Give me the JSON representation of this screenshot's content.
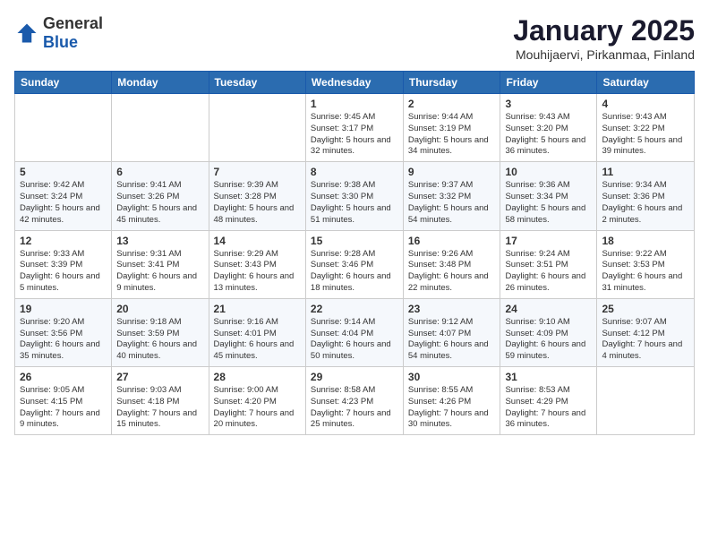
{
  "header": {
    "logo": {
      "general": "General",
      "blue": "Blue"
    },
    "title": "January 2025",
    "subtitle": "Mouhijaervi, Pirkanmaa, Finland"
  },
  "weekdays": [
    "Sunday",
    "Monday",
    "Tuesday",
    "Wednesday",
    "Thursday",
    "Friday",
    "Saturday"
  ],
  "weeks": [
    [
      {
        "day": "",
        "info": ""
      },
      {
        "day": "",
        "info": ""
      },
      {
        "day": "",
        "info": ""
      },
      {
        "day": "1",
        "info": "Sunrise: 9:45 AM\nSunset: 3:17 PM\nDaylight: 5 hours and 32 minutes."
      },
      {
        "day": "2",
        "info": "Sunrise: 9:44 AM\nSunset: 3:19 PM\nDaylight: 5 hours and 34 minutes."
      },
      {
        "day": "3",
        "info": "Sunrise: 9:43 AM\nSunset: 3:20 PM\nDaylight: 5 hours and 36 minutes."
      },
      {
        "day": "4",
        "info": "Sunrise: 9:43 AM\nSunset: 3:22 PM\nDaylight: 5 hours and 39 minutes."
      }
    ],
    [
      {
        "day": "5",
        "info": "Sunrise: 9:42 AM\nSunset: 3:24 PM\nDaylight: 5 hours and 42 minutes."
      },
      {
        "day": "6",
        "info": "Sunrise: 9:41 AM\nSunset: 3:26 PM\nDaylight: 5 hours and 45 minutes."
      },
      {
        "day": "7",
        "info": "Sunrise: 9:39 AM\nSunset: 3:28 PM\nDaylight: 5 hours and 48 minutes."
      },
      {
        "day": "8",
        "info": "Sunrise: 9:38 AM\nSunset: 3:30 PM\nDaylight: 5 hours and 51 minutes."
      },
      {
        "day": "9",
        "info": "Sunrise: 9:37 AM\nSunset: 3:32 PM\nDaylight: 5 hours and 54 minutes."
      },
      {
        "day": "10",
        "info": "Sunrise: 9:36 AM\nSunset: 3:34 PM\nDaylight: 5 hours and 58 minutes."
      },
      {
        "day": "11",
        "info": "Sunrise: 9:34 AM\nSunset: 3:36 PM\nDaylight: 6 hours and 2 minutes."
      }
    ],
    [
      {
        "day": "12",
        "info": "Sunrise: 9:33 AM\nSunset: 3:39 PM\nDaylight: 6 hours and 5 minutes."
      },
      {
        "day": "13",
        "info": "Sunrise: 9:31 AM\nSunset: 3:41 PM\nDaylight: 6 hours and 9 minutes."
      },
      {
        "day": "14",
        "info": "Sunrise: 9:29 AM\nSunset: 3:43 PM\nDaylight: 6 hours and 13 minutes."
      },
      {
        "day": "15",
        "info": "Sunrise: 9:28 AM\nSunset: 3:46 PM\nDaylight: 6 hours and 18 minutes."
      },
      {
        "day": "16",
        "info": "Sunrise: 9:26 AM\nSunset: 3:48 PM\nDaylight: 6 hours and 22 minutes."
      },
      {
        "day": "17",
        "info": "Sunrise: 9:24 AM\nSunset: 3:51 PM\nDaylight: 6 hours and 26 minutes."
      },
      {
        "day": "18",
        "info": "Sunrise: 9:22 AM\nSunset: 3:53 PM\nDaylight: 6 hours and 31 minutes."
      }
    ],
    [
      {
        "day": "19",
        "info": "Sunrise: 9:20 AM\nSunset: 3:56 PM\nDaylight: 6 hours and 35 minutes."
      },
      {
        "day": "20",
        "info": "Sunrise: 9:18 AM\nSunset: 3:59 PM\nDaylight: 6 hours and 40 minutes."
      },
      {
        "day": "21",
        "info": "Sunrise: 9:16 AM\nSunset: 4:01 PM\nDaylight: 6 hours and 45 minutes."
      },
      {
        "day": "22",
        "info": "Sunrise: 9:14 AM\nSunset: 4:04 PM\nDaylight: 6 hours and 50 minutes."
      },
      {
        "day": "23",
        "info": "Sunrise: 9:12 AM\nSunset: 4:07 PM\nDaylight: 6 hours and 54 minutes."
      },
      {
        "day": "24",
        "info": "Sunrise: 9:10 AM\nSunset: 4:09 PM\nDaylight: 6 hours and 59 minutes."
      },
      {
        "day": "25",
        "info": "Sunrise: 9:07 AM\nSunset: 4:12 PM\nDaylight: 7 hours and 4 minutes."
      }
    ],
    [
      {
        "day": "26",
        "info": "Sunrise: 9:05 AM\nSunset: 4:15 PM\nDaylight: 7 hours and 9 minutes."
      },
      {
        "day": "27",
        "info": "Sunrise: 9:03 AM\nSunset: 4:18 PM\nDaylight: 7 hours and 15 minutes."
      },
      {
        "day": "28",
        "info": "Sunrise: 9:00 AM\nSunset: 4:20 PM\nDaylight: 7 hours and 20 minutes."
      },
      {
        "day": "29",
        "info": "Sunrise: 8:58 AM\nSunset: 4:23 PM\nDaylight: 7 hours and 25 minutes."
      },
      {
        "day": "30",
        "info": "Sunrise: 8:55 AM\nSunset: 4:26 PM\nDaylight: 7 hours and 30 minutes."
      },
      {
        "day": "31",
        "info": "Sunrise: 8:53 AM\nSunset: 4:29 PM\nDaylight: 7 hours and 36 minutes."
      },
      {
        "day": "",
        "info": ""
      }
    ]
  ]
}
